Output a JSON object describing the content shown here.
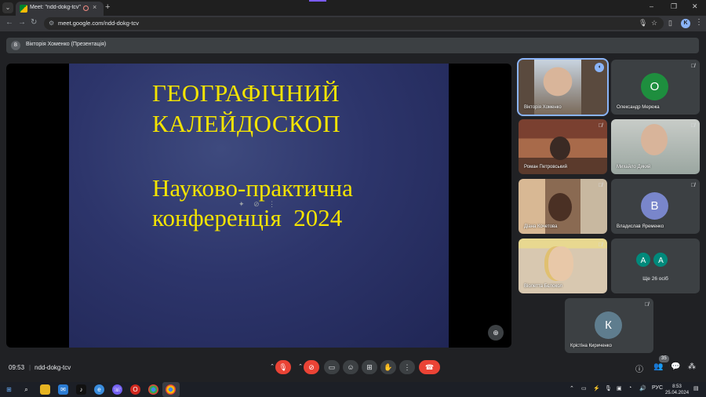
{
  "browser": {
    "tab_title": "Meet: \"ndd-dokg-tcv\"",
    "tab_close": "×",
    "new_tab": "+",
    "url": "meet.google.com/ndd-dokg-tcv",
    "profile_initial": "K"
  },
  "meet": {
    "presenter": {
      "initial": "В",
      "label": "Вікторія Хоменко (Презентація)"
    },
    "slide": {
      "title_line1": "ГЕОГРАФІЧНИЙ",
      "title_line2": "КАЛЕЙДОСКОП",
      "subtitle_line1": "Науково-практична",
      "subtitle_line2": "конференція  2024"
    },
    "participants": [
      {
        "name": "Вікторія Хоменко",
        "type": "video",
        "speaking": true
      },
      {
        "name": "Олександр Мережа",
        "type": "avatar",
        "initial": "О",
        "color": "#1e8e3e",
        "muted": true
      },
      {
        "name": "Роман Петровський",
        "type": "video",
        "muted": true
      },
      {
        "name": "Михайло Дикий",
        "type": "video",
        "muted": true
      },
      {
        "name": "Діана Кочетова",
        "type": "video",
        "muted": true
      },
      {
        "name": "Владислав Яременко",
        "type": "avatar",
        "initial": "В",
        "color": "#7986cb",
        "muted": true
      },
      {
        "name": "Віолетта Бєлокол",
        "type": "video",
        "muted": true
      },
      {
        "name": "Ще 26 осіб",
        "type": "more",
        "initials": [
          "А",
          "А"
        ],
        "color": "#00897b"
      },
      {
        "name": "Крістіна Кириченко",
        "type": "avatar",
        "initial": "К",
        "color": "#5f7d8e",
        "muted": true
      }
    ],
    "callbar": {
      "time": "09:53",
      "separator": "|",
      "meeting_code": "ndd-dokg-tcv",
      "participant_count": "35"
    }
  },
  "taskbar": {
    "language": "РУС",
    "time": "8:53",
    "date": "25.04.2024"
  },
  "colors": {
    "slide_text": "#f4e400",
    "hangup": "#ea4335",
    "speaking_outline": "#8ab4f8"
  }
}
